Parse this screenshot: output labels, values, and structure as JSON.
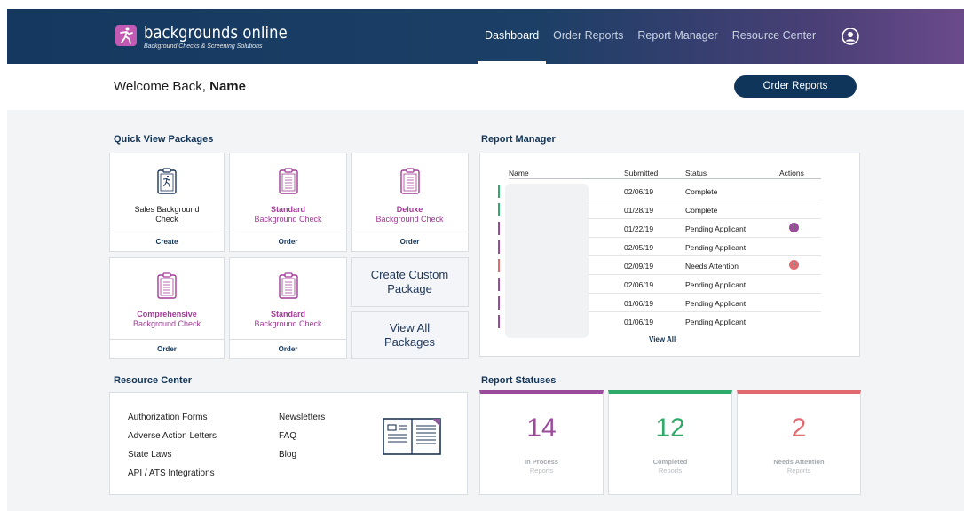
{
  "header": {
    "brand_name": "backgrounds online",
    "brand_tagline": "Background Checks & Screening Solutions",
    "nav": [
      {
        "label": "Dashboard",
        "active": true
      },
      {
        "label": "Order Reports",
        "active": false
      },
      {
        "label": "Report Manager",
        "active": false
      },
      {
        "label": "Resource Center",
        "active": false
      }
    ],
    "user_icon": "user-avatar-icon"
  },
  "welcome": {
    "greeting": "Welcome Back,",
    "name": "Name",
    "order_button": "Order Reports"
  },
  "quick_view": {
    "title": "Quick View Packages",
    "packages": [
      {
        "line1": "Sales Background",
        "line2": "Check",
        "action": "Create",
        "icon": "clipboard-runner-icon"
      },
      {
        "line1": "Standard",
        "line2": "Background Check",
        "action": "Order",
        "icon": "clipboard-icon"
      },
      {
        "line1": "Deluxe",
        "line2": "Background Check",
        "action": "Order",
        "icon": "clipboard-icon"
      },
      {
        "line1": "Comprehensive",
        "line2": "Background Check",
        "action": "Order",
        "icon": "clipboard-icon"
      },
      {
        "line1": "Standard",
        "line2": "Background Check",
        "action": "Order",
        "icon": "clipboard-icon"
      }
    ],
    "custom_package": "Create Custom Package",
    "view_all_packages": "View All Packages"
  },
  "report_manager": {
    "title": "Report Manager",
    "columns": [
      "Name",
      "Submitted",
      "Status",
      "Actions"
    ],
    "rows": [
      {
        "submitted": "02/06/19",
        "status": "Complete",
        "alert": false
      },
      {
        "submitted": "01/28/19",
        "status": "Complete",
        "alert": false
      },
      {
        "submitted": "01/22/19",
        "status": "Pending Applicant",
        "alert": true
      },
      {
        "submitted": "02/05/19",
        "status": "Pending Applicant",
        "alert": false
      },
      {
        "submitted": "02/09/19",
        "status": "Needs Attention",
        "alert": true
      },
      {
        "submitted": "02/06/19",
        "status": "Pending Applicant",
        "alert": false
      },
      {
        "submitted": "01/06/19",
        "status": "Pending Applicant",
        "alert": false
      },
      {
        "submitted": "01/06/19",
        "status": "Pending Applicant",
        "alert": false
      }
    ],
    "alert_glyph": "!",
    "view_all": "View All"
  },
  "resource_center": {
    "title": "Resource Center",
    "links_left": [
      "Authorization Forms",
      "Adverse Action Letters",
      "State Laws",
      "API / ATS Integrations"
    ],
    "links_right": [
      "Newsletters",
      "FAQ",
      "Blog"
    ],
    "icon": "open-book-icon"
  },
  "report_statuses": {
    "title": "Report Statuses",
    "cards": [
      {
        "count": "14",
        "label": "In Process",
        "sub": "Reports",
        "color": "#9b4a9c"
      },
      {
        "count": "12",
        "label": "Completed",
        "sub": "Reports",
        "color": "#2eaa6b"
      },
      {
        "count": "2",
        "label": "Needs Attention",
        "sub": "Reports",
        "color": "#e06a6f"
      }
    ]
  },
  "colors": {
    "navy": "#10355b",
    "purple": "#a23b97",
    "green": "#2eaa6b",
    "red": "#e06a6f"
  }
}
